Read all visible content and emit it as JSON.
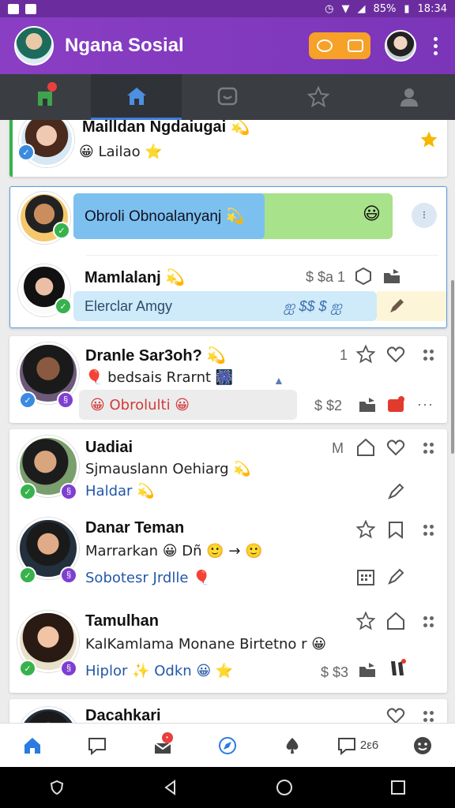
{
  "status_bar": {
    "battery": "85%",
    "time": "18:34"
  },
  "app": {
    "title": "Ngana Sosial",
    "header_action_icons": [
      "sync-icon",
      "video-icon"
    ]
  },
  "colors": {
    "appbar": "#7b35b8",
    "tabbar": "#3a3d42",
    "accent_blue": "#3d7ed6",
    "chip_blue": "#7cc0ef",
    "chip_green": "#a8e28a",
    "chip_light_blue": "#cfeaf8",
    "star_gold": "#f5b700",
    "red": "#e83f3f"
  },
  "top_tabs": [
    {
      "icon": "notification-bin-icon",
      "active": false,
      "has_dot": true
    },
    {
      "icon": "home-icon",
      "active": true
    },
    {
      "icon": "chat-icon",
      "active": false
    },
    {
      "icon": "star-icon",
      "active": false
    },
    {
      "icon": "person-icon",
      "active": false
    }
  ],
  "feed": {
    "card1": {
      "name": "Mailldan Ngdaiugai 💫",
      "sub": "😀 Lailao ⭐"
    },
    "card2": {
      "bubble": "Obroli Obnoalanyanj 💫",
      "bubble_emoji": "😃",
      "name": "Mamlalanj 💫",
      "meta": "$ $a 1",
      "chip": "Elerclar Amgy",
      "chip_meta": "ஐ $$ $ ஐ"
    },
    "card3": {
      "name": "Dranle Sar3oh? 💫",
      "sub": "🎈 bedsais Rrarnt 🎆",
      "count": "1",
      "chip": "😀 Obrolulti 😀",
      "meta": "$ $2"
    },
    "card4": {
      "item1": {
        "name": "Uadiai",
        "sub": "Sjmauslann Oehiarg 💫",
        "tag": "Haldar 💫",
        "letter": "M"
      },
      "item2": {
        "name": "Danar Teman",
        "sub": "Marrarkan 😀 Dñ 🙂 → 🙂",
        "tag": "Sobotesr Jrdlle 🎈"
      },
      "item3": {
        "name": "Tamulhan",
        "sub": "KalKamlama Monane Birtetno r 😀",
        "tag": "Hiplor ✨ Odkn 😀 ⭐",
        "meta": "$ $3"
      }
    },
    "card5": {
      "name": "Dacahkari"
    }
  },
  "bottom_nav": [
    {
      "icon": "home-icon",
      "active": true
    },
    {
      "icon": "chat-bubble-icon"
    },
    {
      "icon": "inbox-icon",
      "badge": true
    },
    {
      "icon": "compass-icon"
    },
    {
      "icon": "spade-icon"
    },
    {
      "icon": "comment-icon",
      "label": "2ε6"
    },
    {
      "icon": "face-icon"
    }
  ],
  "system_nav": [
    "shield-icon",
    "back-icon",
    "home-circle-icon",
    "recents-icon"
  ]
}
